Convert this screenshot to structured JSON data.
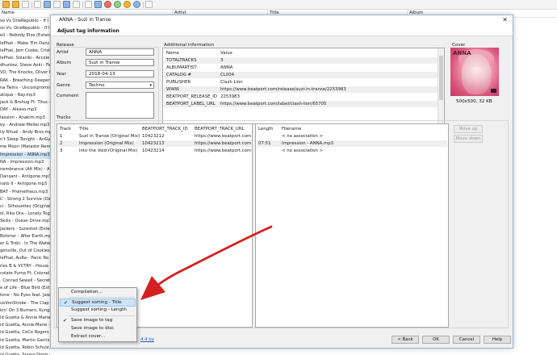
{
  "app": {
    "columns": {
      "name": "Name",
      "artist": "Artist",
      "title": "Title",
      "album": "Album"
    },
    "files": [
      "so Vs OneRepublic - If I",
      "so Vs. OneRepublic - If I L",
      "ell - Nobody Else (Extend",
      "lePhat - Make 'Em Danc",
      "lePhat, Jem Cooke, Crist",
      "lePhat, Solardo - Accele",
      "dhuntez, Steve Aoki - Fe",
      "VO, The Knocks, Oliver H",
      "RAK - Breathing Deeper (",
      "na Twins - Uncompromis",
      "atique - Ray.mp3",
      "jack & Brohug Ft. Titus -",
      "DAY - Alesso.mp3",
      "lession - Anakim.mp3",
      "ey - Andrew Meller.mp3",
      "ily Ritual - Andy Bros.mp",
      "n't Sleep Tonight - AnGy",
      "me Moon (Matador Remix",
      "Impression - ANNA.mp3",
      "NA - Impression.mp3",
      "nembrance (Alt Mix) - A",
      "Dansant - Antigone.mp3",
      "nato II - Antigone.mp3",
      "BAT - Prometheus.mp3",
      "C - Strong 2 Survive (Dar",
      "ci - Silhouettes (Original",
      "ol, Rita Ora - Lonely Toge",
      "Skills - Ocean Drive.mp3",
      "jackers - Sureshot (Exten",
      "Bohmer - After Earth.mp",
      "er & Trobi - In The Water",
      "genville, Out of Cookies",
      "lePhat, AuRa - Panic Ro",
      "rles B & VCTRY - House",
      "colate Puma Ft. Colonel",
      ". Conrad Sewell - Secrets",
      "e of Life - Blue Bird (Ext",
      "tone - No Eyes feat. Jaw",
      "uoVonStroke - The Clap",
      "kin' On 3 Burners, Kungs",
      "id Guetta & Annie-Marie -",
      "id Guetta, Annie-Marie -",
      "id Guetta, CeCe Rogers -",
      "id Guetta, Martin Garrix, B",
      "id Guetta, Robin Schulz, C",
      "id Guetta, Snoop Dogg -"
    ]
  },
  "dialog": {
    "title": "ANNA - Suzi in Transe",
    "heading": "Adjust tag information",
    "release": {
      "label": "Release",
      "artist_label": "Artist",
      "artist": "ANNA",
      "album_label": "Album",
      "album": "Suzi in Transe",
      "year_label": "Year",
      "year": "2018-04-13",
      "genre_label": "Genre",
      "genre": "Techno",
      "comment_label": "Comment"
    },
    "additional": {
      "label": "Additional information",
      "col_name": "Name",
      "col_value": "Value",
      "rows": [
        {
          "name": "TOTALTRACKS",
          "value": "3"
        },
        {
          "name": "ALBUMARTIST",
          "value": "ANNA"
        },
        {
          "name": "CATALOG #",
          "value": "CL004"
        },
        {
          "name": "PUBLISHER",
          "value": "Clash Lion"
        },
        {
          "name": "WWW",
          "value": "https://www.beatport.com/release/suzi-in-transe/2253983"
        },
        {
          "name": "BEATPORT_RELEASE_ID",
          "value": "2253983"
        },
        {
          "name": "BEATPORT_LABEL_URL",
          "value": "https://www.beatport.com/label/clash-lion/65705"
        }
      ]
    },
    "cover": {
      "label": "Cover",
      "art_text": "ANNA",
      "caption": "500x500, 32 KB"
    },
    "tracks": {
      "label": "Tracks",
      "headers": [
        "Track",
        "Title",
        "BEATPORT_TRACK_ID",
        "BEATPORT_TRACK_URL"
      ],
      "rows": [
        {
          "track": "1",
          "title": "Suzi in Transe (Original Mix)",
          "id": "10423212",
          "url": "https://www.beatport.com/tr"
        },
        {
          "track": "2",
          "title": "Impression (Original Mix)",
          "id": "10423213",
          "url": "https://www.beatport.com/tr"
        },
        {
          "track": "3",
          "title": "Into the Void (Original Mix)",
          "id": "10423214",
          "url": "https://www.beatport.com/tr"
        }
      ],
      "files_headers": [
        "Length",
        "Filename"
      ],
      "files_rows": [
        {
          "length": "",
          "filename": "< no association >"
        },
        {
          "length": "07:51",
          "filename": "Impression - ANNA.mp3"
        },
        {
          "length": "",
          "filename": "< no association >"
        }
      ],
      "move_up": "Move up",
      "move_down": "Move down"
    },
    "context_menu": {
      "compilation": "Compilation...",
      "sort_title": "Suggest sorting - Title",
      "sort_length": "Suggest sorting - Length",
      "save_to_tag": "Save image to tag",
      "save_to_disc": "Save image to disc",
      "extract_cover": "Extract cover..."
    },
    "link_fragment": "4.4 by",
    "buttons": {
      "back": "< Back",
      "ok": "OK",
      "cancel": "Cancel",
      "help": "Help"
    }
  }
}
